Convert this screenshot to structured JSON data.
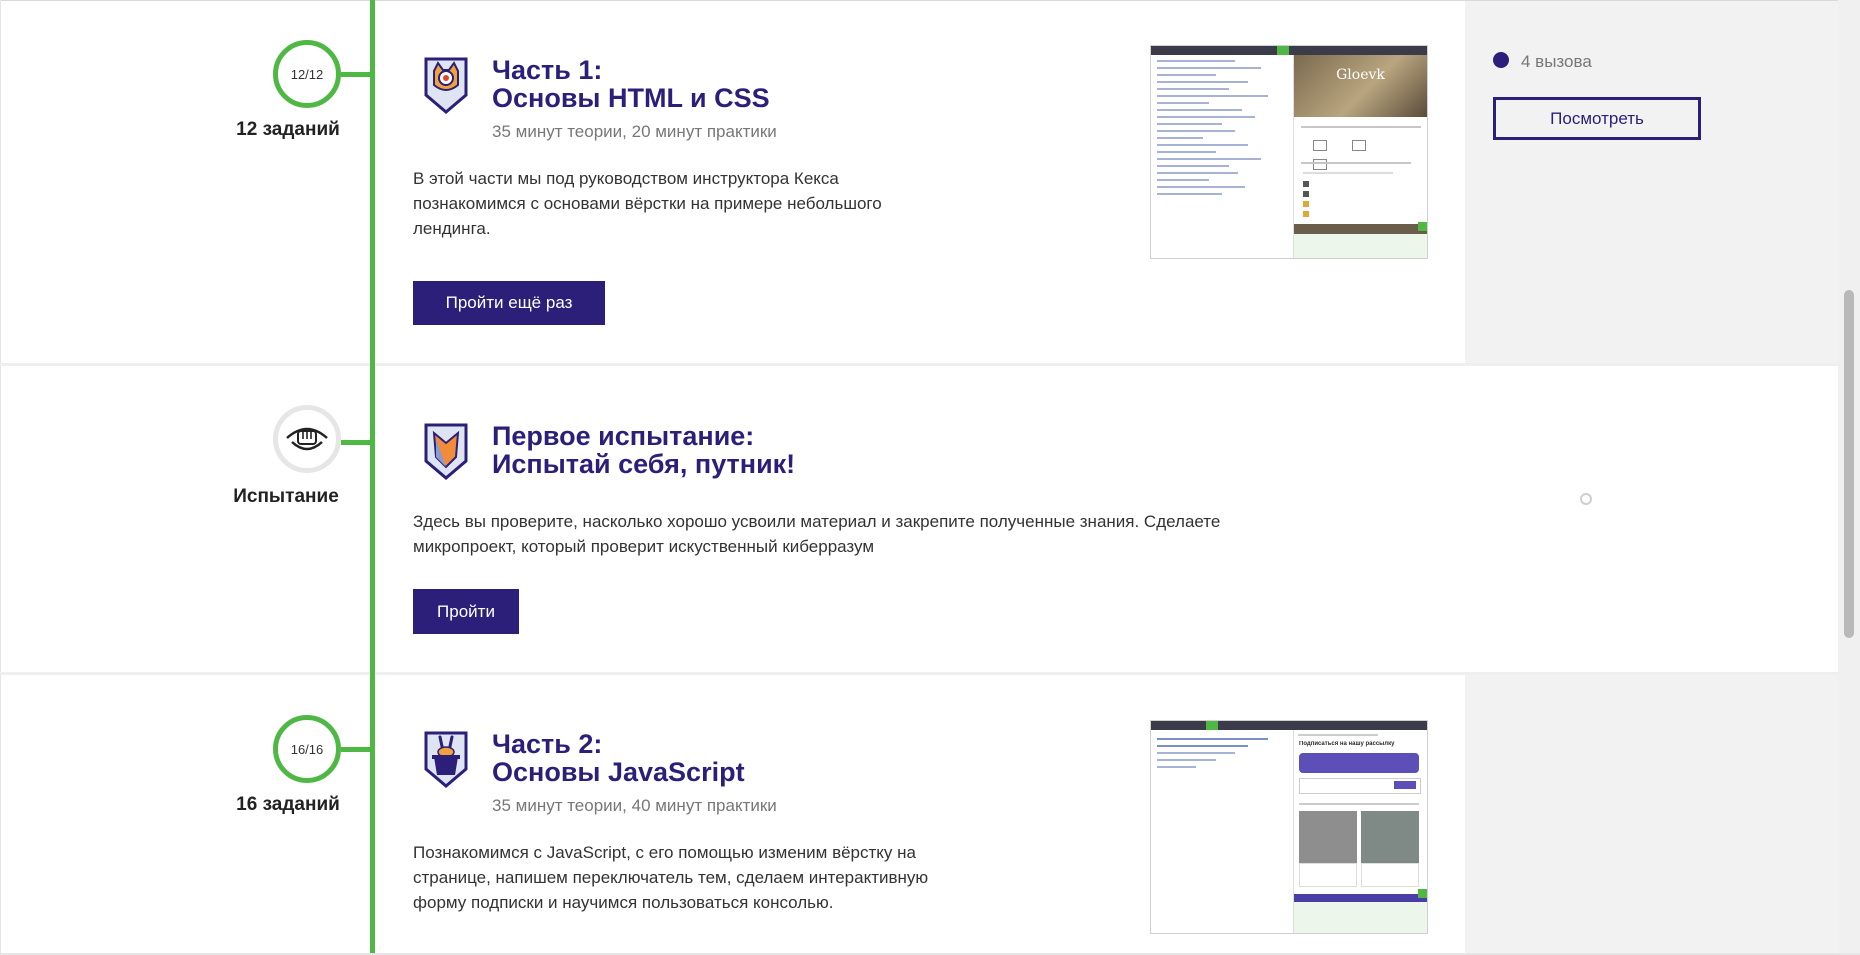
{
  "colors": {
    "accent": "#2b1f7a",
    "timeline_green": "#4fb845",
    "panel_gray": "#f2f2f2"
  },
  "modules": [
    {
      "progress": "12/12",
      "tasks_label": "12 заданий",
      "badge_icon": "cat-mascot-shield-icon",
      "title_line1": "Часть 1:",
      "title_line2": "Основы HTML и CSS",
      "meta": "35 минут теории, 20 минут практики",
      "description": "В этой части мы под руководством инструктора Кекса познакомимся с основами вёрстки на примере небольшого лендинга.",
      "button_label": "Пройти ещё раз",
      "preview": {
        "site_title": "Gloevk"
      },
      "challenges": {
        "count_label": "4 вызова",
        "button_label": "Посмотреть"
      }
    },
    {
      "progress": "",
      "tasks_label": "Испытание",
      "node_icon": "fist-emblem-icon",
      "badge_icon": "fox-shield-icon",
      "title_line1": "Первое испытание:",
      "title_line2": "Испытай себя, путник!",
      "description": "Здесь вы проверите, насколько хорошо усвоили материал и закрепите полученные знания. Сделаете микропроект, который проверит искуственный киберразум",
      "button_label": "Пройти"
    },
    {
      "progress": "16/16",
      "tasks_label": "16 заданий",
      "badge_icon": "magic-hat-rabbit-shield-icon",
      "title_line1": "Часть 2:",
      "title_line2": "Основы JavaScript",
      "meta": "35 минут теории, 40 минут практики",
      "description": "Познакомимся с JavaScript, с его помощью изменим вёрстку на странице, напишем переключатель тем, сделаем интерактивную форму подписки и научимся пользоваться консолью.",
      "preview": {
        "site_title": "Подписаться на нашу рассылку"
      }
    }
  ]
}
